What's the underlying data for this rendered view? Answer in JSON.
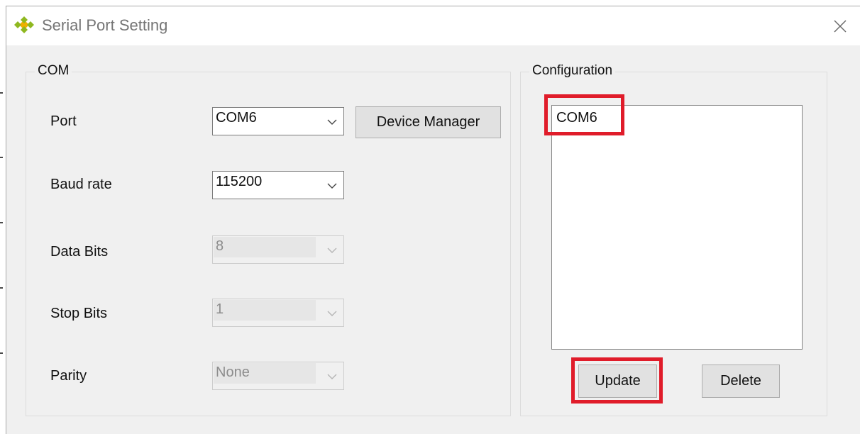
{
  "window": {
    "title": "Serial Port Setting"
  },
  "icons": {
    "app": "app-logo-icon",
    "close": "close-icon",
    "dropdown": "chevron-down-icon"
  },
  "colors": {
    "highlight": "#e01c2a",
    "app_icon": [
      "#8fb820",
      "#f0b000"
    ]
  },
  "com": {
    "group_label": "COM",
    "port": {
      "label": "Port",
      "value": "COM6"
    },
    "device_manager_label": "Device Manager",
    "baud_rate": {
      "label": "Baud rate",
      "value": "115200"
    },
    "data_bits": {
      "label": "Data Bits",
      "value": "8"
    },
    "stop_bits": {
      "label": "Stop Bits",
      "value": "1"
    },
    "parity": {
      "label": "Parity",
      "value": "None"
    }
  },
  "configuration": {
    "group_label": "Configuration",
    "items": [
      "COM6"
    ],
    "update_label": "Update",
    "delete_label": "Delete"
  }
}
